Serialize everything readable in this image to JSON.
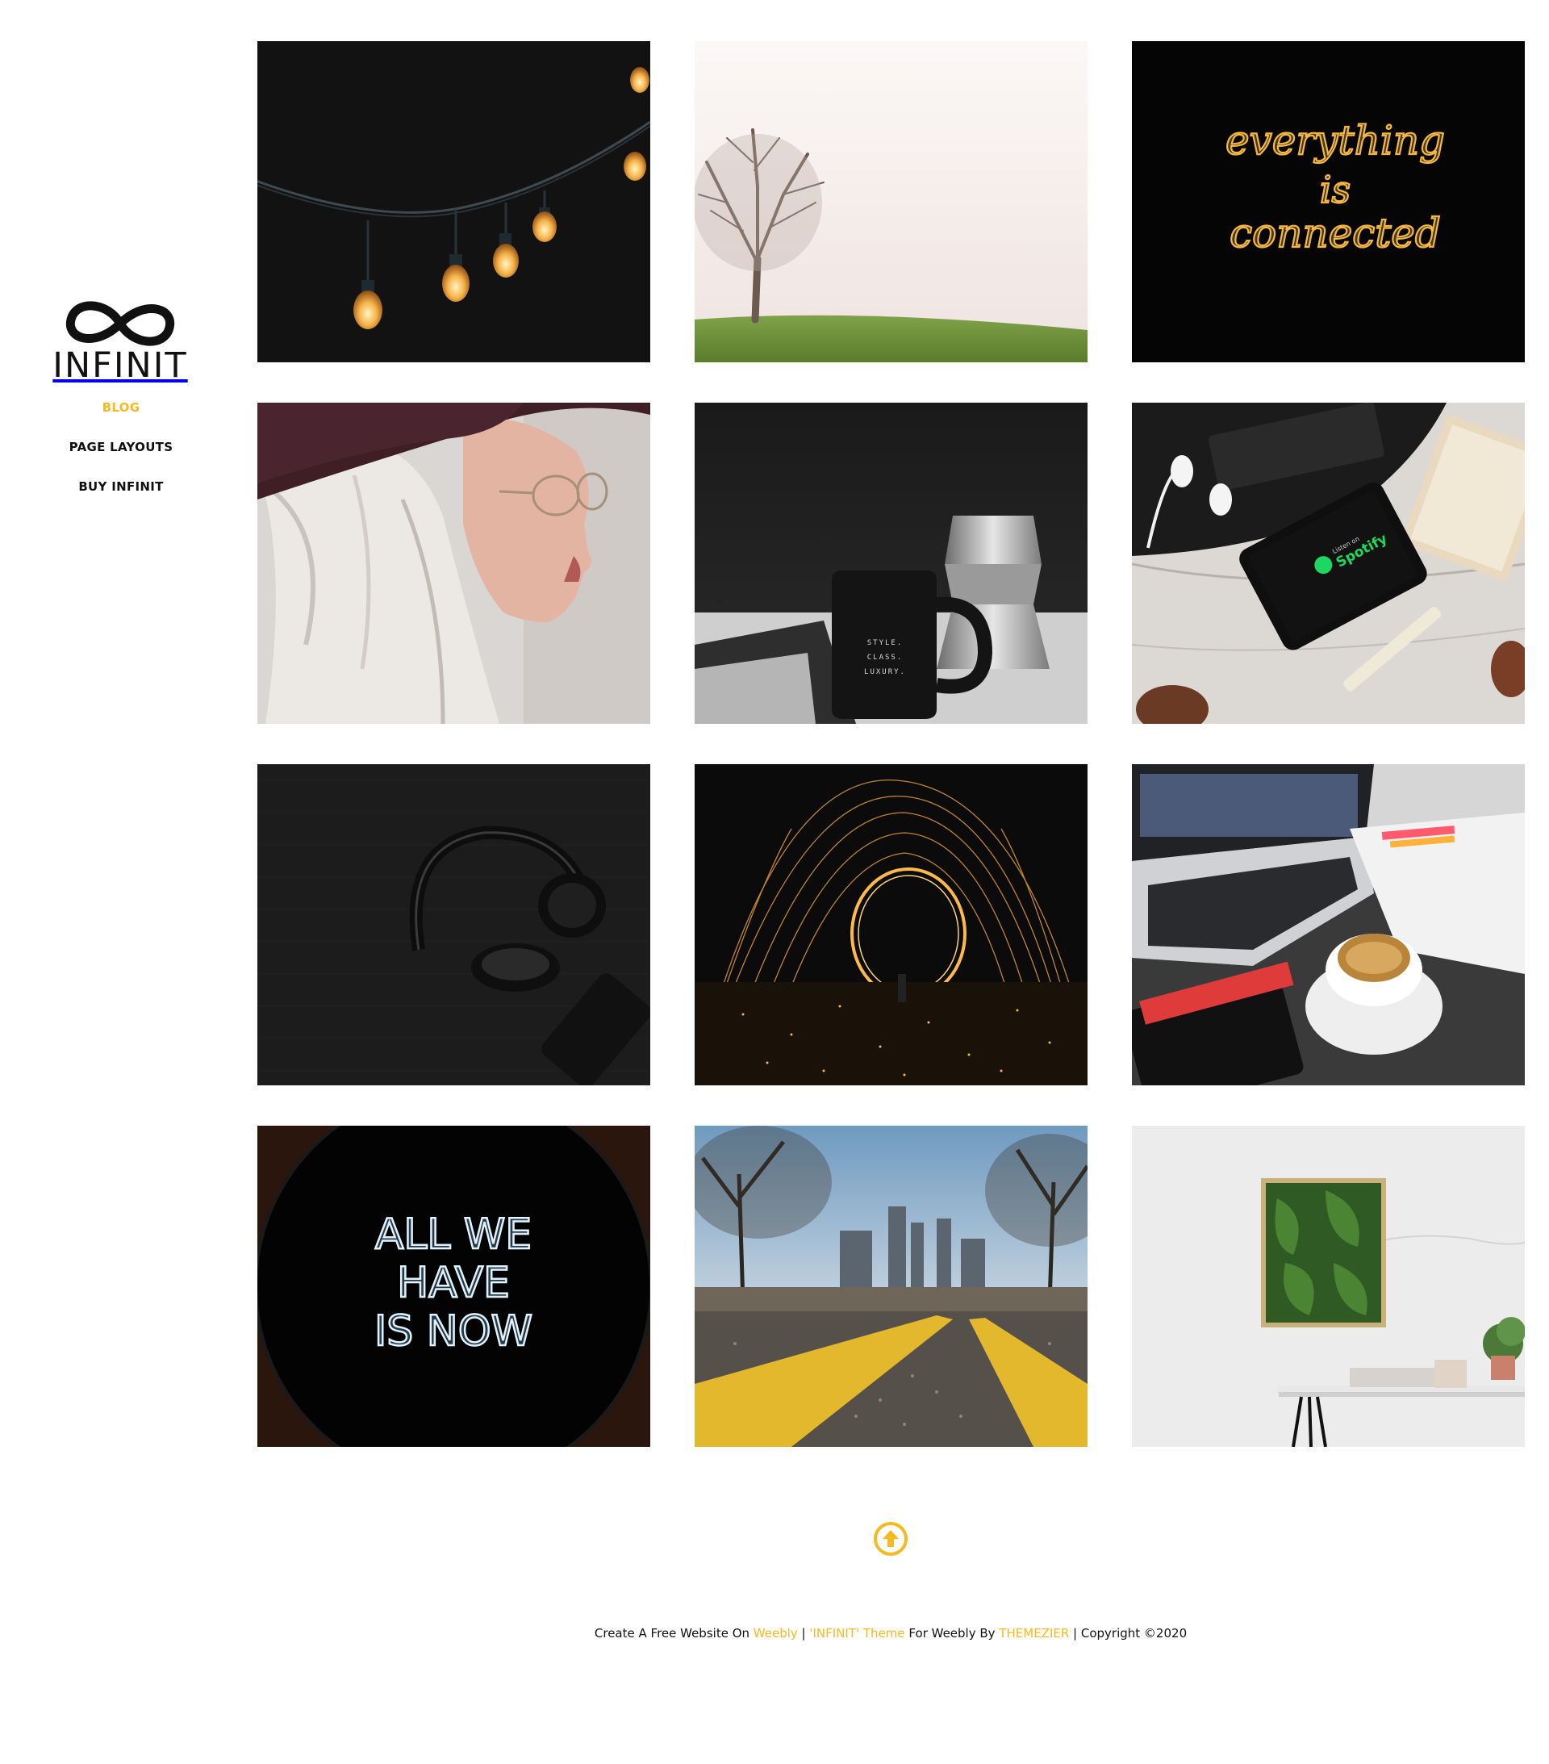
{
  "brand": {
    "name": "INFINIT",
    "logo_icon": "infinity-icon",
    "accent": "#f5b921"
  },
  "nav": {
    "items": [
      {
        "label": "BLOG",
        "active": true
      },
      {
        "label": "PAGE LAYOUTS",
        "active": false
      },
      {
        "label": "BUY INFINIT",
        "active": false
      }
    ]
  },
  "gallery": {
    "tiles": [
      {
        "subject": "string-lights"
      },
      {
        "subject": "lone-tree"
      },
      {
        "subject": "neon-everything-is-connected",
        "neon_text": [
          "everything",
          "is",
          "connected"
        ]
      },
      {
        "subject": "woman-portrait"
      },
      {
        "subject": "mug-and-coffee-pot",
        "mug_text": [
          "STYLE.",
          "CLASS.",
          "LUXURY."
        ]
      },
      {
        "subject": "phone-spotify",
        "phone_text": [
          "Listen on",
          "Spotify"
        ]
      },
      {
        "subject": "headphones"
      },
      {
        "subject": "steel-wool-spin"
      },
      {
        "subject": "laptop-and-coffee"
      },
      {
        "subject": "neon-all-we-have-is-now",
        "neon_text": [
          "ALL WE",
          "HAVE",
          "IS NOW"
        ]
      },
      {
        "subject": "road-city"
      },
      {
        "subject": "plant-frame-desk"
      }
    ]
  },
  "back_to_top": {
    "icon": "arrow-up-circle-icon"
  },
  "footer": {
    "prefix": "Create A Free Website On",
    "weebly_link": "Weebly",
    "sep1": " | ",
    "theme_link": "'INFINIT' Theme",
    "middle": "For Weebly By",
    "author_link": "THEMEZIER",
    "suffix": " | Copyright ©2020"
  }
}
